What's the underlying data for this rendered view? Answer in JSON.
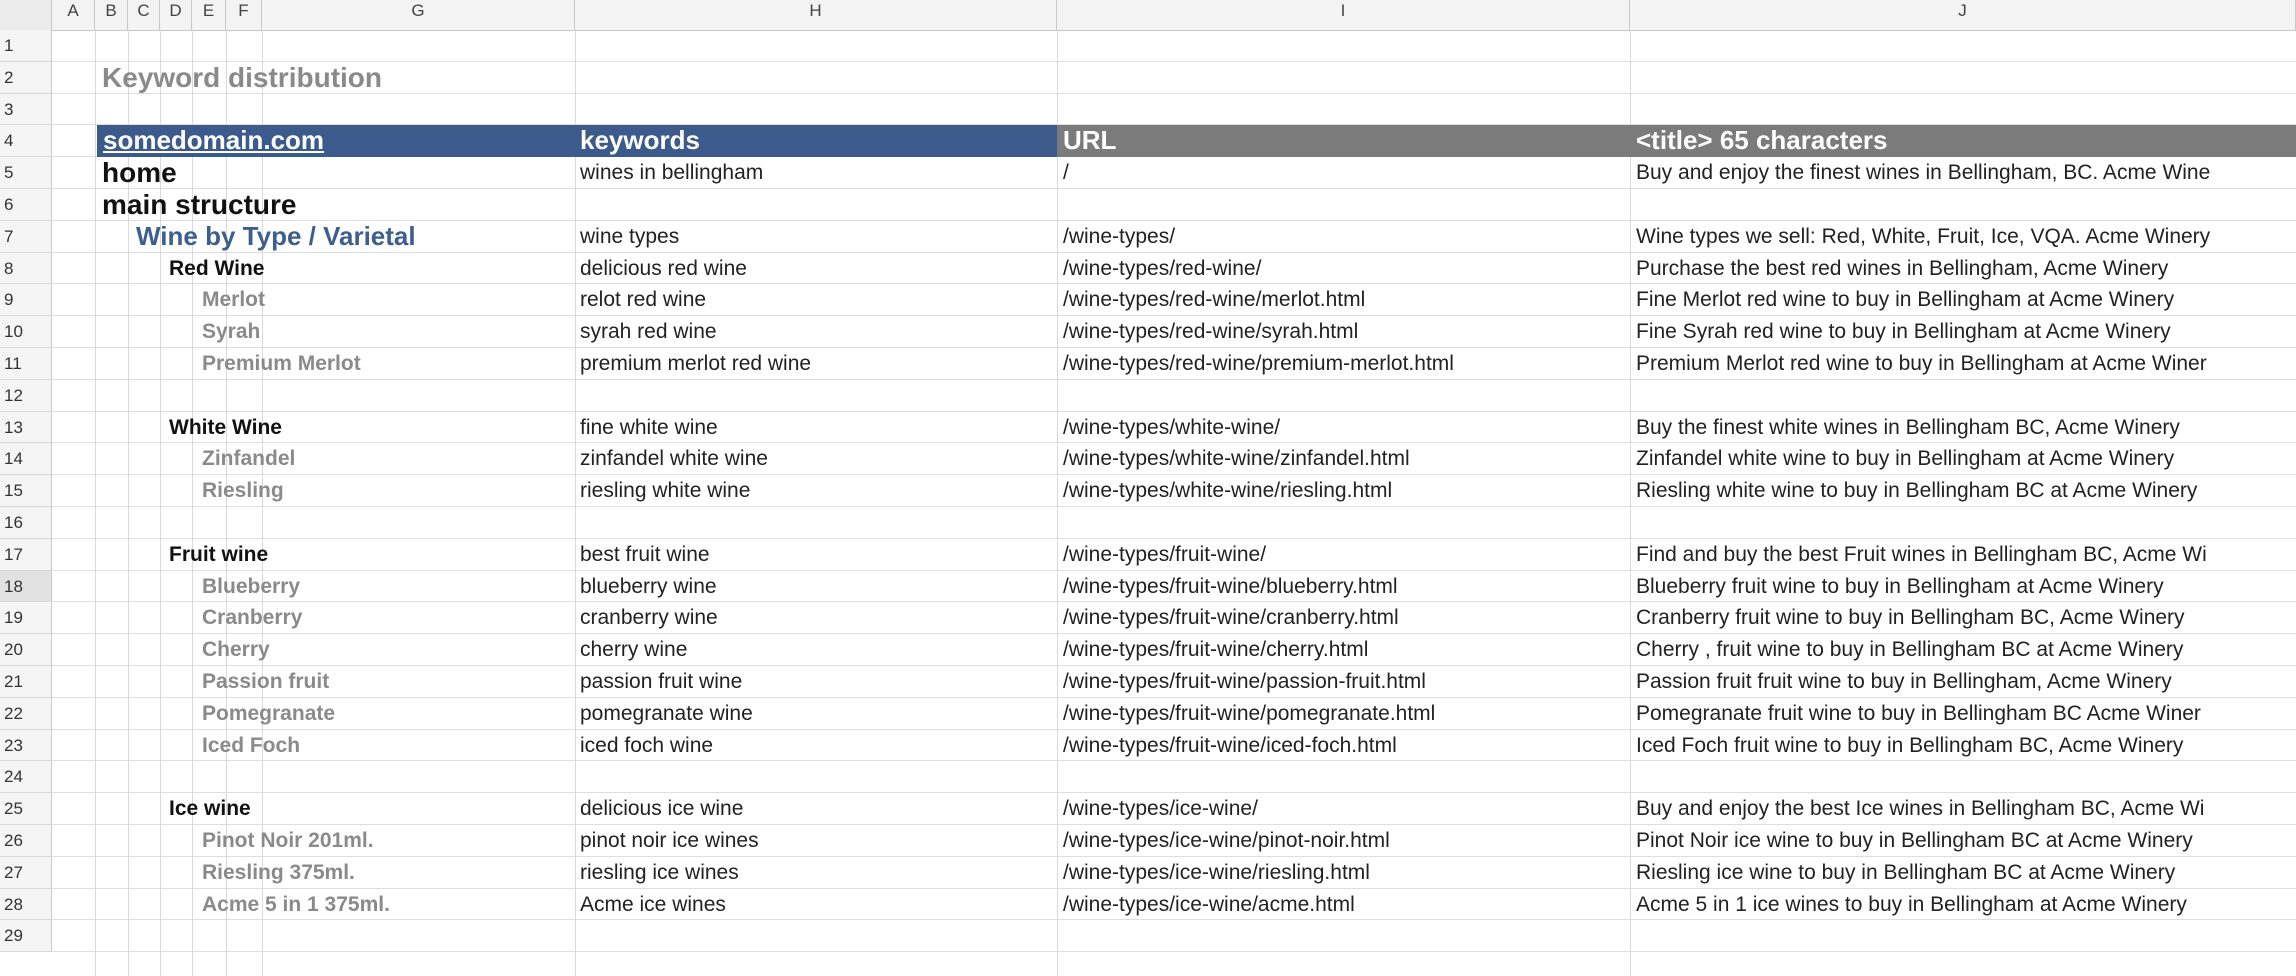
{
  "columns": [
    "A",
    "B",
    "C",
    "D",
    "E",
    "F",
    "G",
    "H",
    "I",
    "J"
  ],
  "row_numbers": [
    "1",
    "2",
    "3",
    "4",
    "5",
    "6",
    "7",
    "8",
    "9",
    "10",
    "11",
    "12",
    "13",
    "14",
    "15",
    "16",
    "17",
    "18",
    "19",
    "20",
    "21",
    "22",
    "23",
    "24",
    "25",
    "26",
    "27",
    "28",
    "29"
  ],
  "selected_row": "18",
  "sheet_title": "Keyword distribution",
  "header": {
    "site": "somedomain.com",
    "keywords": "keywords",
    "url": "URL",
    "title": "<title> 65 characters"
  },
  "colors": {
    "header_blue": "#3c5b8c",
    "header_gray": "#7b7b7b",
    "section_blue": "#3d5f8f",
    "muted_gray": "#8a8a8a"
  },
  "rows": [
    {
      "row": 5,
      "level": 0,
      "name": "home",
      "keywords": "wines in bellingham",
      "url": "/",
      "title": "Buy and enjoy the finest wines in Bellingham, BC. Acme Wine"
    },
    {
      "row": 6,
      "level": 0,
      "name": "main structure",
      "keywords": "",
      "url": "",
      "title": ""
    },
    {
      "row": 7,
      "level": 1,
      "name": "Wine by Type / Varietal",
      "keywords": "wine types",
      "url": "/wine-types/",
      "title": "Wine types we sell: Red, White, Fruit, Ice, VQA. Acme Winery"
    },
    {
      "row": 8,
      "level": 2,
      "name": "Red Wine",
      "keywords": "delicious red wine",
      "url": "/wine-types/red-wine/",
      "title": "Purchase the best red wines in Bellingham, Acme Winery"
    },
    {
      "row": 9,
      "level": 3,
      "name": "Merlot",
      "keywords": "relot red wine",
      "url": "/wine-types/red-wine/merlot.html",
      "title": "Fine Merlot  red wine to buy in Bellingham at Acme Winery"
    },
    {
      "row": 10,
      "level": 3,
      "name": "Syrah",
      "keywords": "syrah red wine",
      "url": "/wine-types/red-wine/syrah.html",
      "title": "Fine Syrah  red wine to buy in Bellingham at Acme Winery"
    },
    {
      "row": 11,
      "level": 3,
      "name": "Premium Merlot",
      "keywords": "premium merlot red wine",
      "url": "/wine-types/red-wine/premium-merlot.html",
      "title": "Premium Merlot red wine to buy in Bellingham at Acme Winer"
    },
    {
      "row": 13,
      "level": 2,
      "name": "White Wine",
      "keywords": "fine white wine",
      "url": "/wine-types/white-wine/",
      "title": "Buy the finest white wines in Bellingham BC, Acme Winery"
    },
    {
      "row": 14,
      "level": 3,
      "name": "Zinfandel",
      "keywords": "zinfandel white wine",
      "url": "/wine-types/white-wine/zinfandel.html",
      "title": "Zinfandel  white wine to buy in Bellingham at Acme Winery"
    },
    {
      "row": 15,
      "level": 3,
      "name": "Riesling",
      "keywords": "riesling white wine",
      "url": "/wine-types/white-wine/riesling.html",
      "title": "Riesling white wine  to buy in Bellingham BC at Acme Winery"
    },
    {
      "row": 17,
      "level": 2,
      "name": "Fruit wine",
      "keywords": "best fruit wine",
      "url": "/wine-types/fruit-wine/",
      "title": "Find and buy the best Fruit wines in Bellingham BC, Acme Wi"
    },
    {
      "row": 18,
      "level": 3,
      "name": "Blueberry",
      "keywords": "blueberry wine",
      "url": "/wine-types/fruit-wine/blueberry.html",
      "title": "Blueberry fruit wine  to buy in Bellingham at Acme Winery"
    },
    {
      "row": 19,
      "level": 3,
      "name": "Cranberry",
      "keywords": "cranberry wine",
      "url": "/wine-types/fruit-wine/cranberry.html",
      "title": "Cranberry  fruit wine to buy in Bellingham BC, Acme Winery"
    },
    {
      "row": 20,
      "level": 3,
      "name": "Cherry",
      "keywords": "cherry wine",
      "url": "/wine-types/fruit-wine/cherry.html",
      "title": "Cherry , fruit wine to buy in Bellingham BC at Acme Winery"
    },
    {
      "row": 21,
      "level": 3,
      "name": "Passion fruit",
      "keywords": "passion fruit wine",
      "url": "/wine-types/fruit-wine/passion-fruit.html",
      "title": "Passion fruit  fruit wine to buy in Bellingham, Acme Winery"
    },
    {
      "row": 22,
      "level": 3,
      "name": "Pomegranate",
      "keywords": "pomegranate wine",
      "url": "/wine-types/fruit-wine/pomegranate.html",
      "title": "Pomegranate fruit wine  to buy in Bellingham BC Acme Winer"
    },
    {
      "row": 23,
      "level": 3,
      "name": "Iced Foch",
      "keywords": "iced foch wine",
      "url": "/wine-types/fruit-wine/iced-foch.html",
      "title": "Iced Foch  fruit wine to buy in Bellingham BC, Acme Winery"
    },
    {
      "row": 25,
      "level": 2,
      "name": "Ice wine",
      "keywords": "delicious ice wine",
      "url": "/wine-types/ice-wine/",
      "title": "Buy and enjoy the best Ice wines in Bellingham BC, Acme Wi"
    },
    {
      "row": 26,
      "level": 3,
      "name": "Pinot Noir  201ml.",
      "keywords": "pinot noir ice wines",
      "url": "/wine-types/ice-wine/pinot-noir.html",
      "title": "Pinot Noir  ice wine to buy in Bellingham BC at Acme Winery"
    },
    {
      "row": 27,
      "level": 3,
      "name": "Riesling  375ml.",
      "keywords": "riesling ice wines",
      "url": "/wine-types/ice-wine/riesling.html",
      "title": "Riesling ice wine  to buy in Bellingham BC at Acme Winery"
    },
    {
      "row": 28,
      "level": 3,
      "name": "Acme 5 in 1 375ml.",
      "keywords": "Acme ice wines",
      "url": "/wine-types/ice-wine/acme.html",
      "title": "Acme 5 in 1 ice wines to buy in Bellingham at Acme Winery"
    }
  ]
}
